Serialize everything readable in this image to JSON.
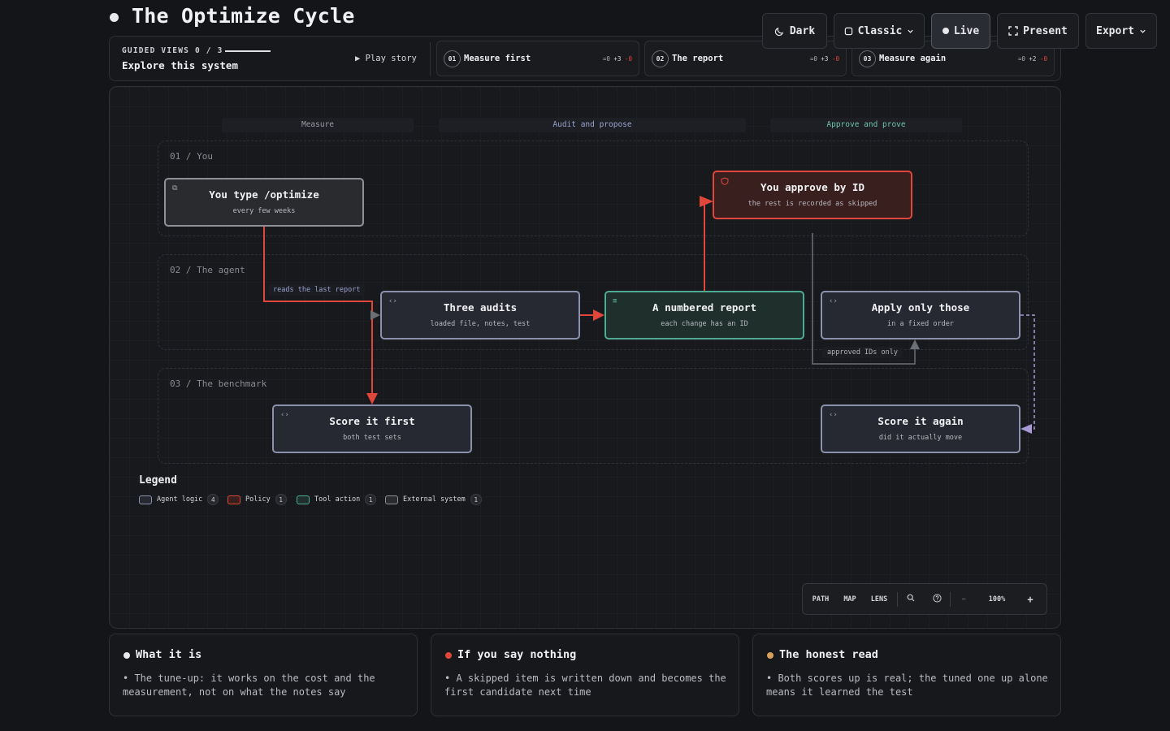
{
  "page_title": "The Optimize Cycle",
  "toolbar_top": {
    "theme": "Dark",
    "style": "Classic",
    "live": "Live",
    "present": "Present",
    "export": "Export"
  },
  "guided": {
    "label": "GUIDED VIEWS 0 / 3",
    "explore": "Explore this system",
    "play": "▶ Play story",
    "steps": [
      {
        "num": "01",
        "title": "Measure first",
        "eq": "=0",
        "plus": "+3",
        "minus": "-0"
      },
      {
        "num": "02",
        "title": "The report",
        "eq": "=0",
        "plus": "+3",
        "minus": "-0"
      },
      {
        "num": "03",
        "title": "Measure again",
        "eq": "=0",
        "plus": "+2",
        "minus": "-0"
      }
    ]
  },
  "diagram": {
    "columns": [
      {
        "label": "Measure",
        "color": "#9a9ca4"
      },
      {
        "label": "Audit and propose",
        "color": "#9aa3d0"
      },
      {
        "label": "Approve and prove",
        "color": "#6fc2a8"
      }
    ],
    "lanes": [
      "01 / You",
      "02 / The agent",
      "03 / The benchmark"
    ],
    "nodes": {
      "type_optimize": {
        "title": "You type /optimize",
        "sub": "every few weeks",
        "kind": "external",
        "icon": "external-system-icon"
      },
      "approve": {
        "title": "You approve by ID",
        "sub": "the rest is recorded as skipped",
        "kind": "policy",
        "icon": "shield-icon"
      },
      "audits": {
        "title": "Three audits",
        "sub": "loaded file, notes, test",
        "kind": "agent",
        "icon": "code-icon"
      },
      "report": {
        "title": "A numbered report",
        "sub": "each change has an ID",
        "kind": "tool",
        "icon": "list-icon"
      },
      "apply": {
        "title": "Apply only those",
        "sub": "in a fixed order",
        "kind": "agent",
        "icon": "code-icon"
      },
      "score_first": {
        "title": "Score it first",
        "sub": "both test sets",
        "kind": "agent",
        "icon": "code-icon"
      },
      "score_again": {
        "title": "Score it again",
        "sub": "did it actually move",
        "kind": "agent",
        "icon": "code-icon"
      }
    },
    "edge_labels": {
      "reads": "reads the last report",
      "approved": "approved IDs only"
    },
    "colors": {
      "agent": "#8b91ad",
      "policy": "#e0473a",
      "tool": "#4faa93",
      "external": "#8e9096",
      "dashed_edge": "#a79ad6"
    }
  },
  "legend": {
    "title": "Legend",
    "items": [
      {
        "label": "Agent logic",
        "count": "4",
        "color": "#8b91ad"
      },
      {
        "label": "Policy",
        "count": "1",
        "color": "#e0473a"
      },
      {
        "label": "Tool action",
        "count": "1",
        "color": "#4faa93"
      },
      {
        "label": "External system",
        "count": "1",
        "color": "#8e9096"
      }
    ]
  },
  "view_toolbar": {
    "path": "PATH",
    "map": "MAP",
    "lens": "LENS",
    "zoom_out": "−",
    "zoom": "100%",
    "zoom_in": "+"
  },
  "cards": [
    {
      "title": "What it is",
      "dot": "#e9e9ec",
      "body": "• The tune-up: it works on the cost and the measurement, not on what the notes say"
    },
    {
      "title": "If you say nothing",
      "dot": "#e0473a",
      "body": "• A skipped item is written down and becomes the first candidate next time"
    },
    {
      "title": "The honest read",
      "dot": "#d9a05a",
      "body": "• Both scores up is real; the tuned one up alone means it learned the test"
    }
  ]
}
